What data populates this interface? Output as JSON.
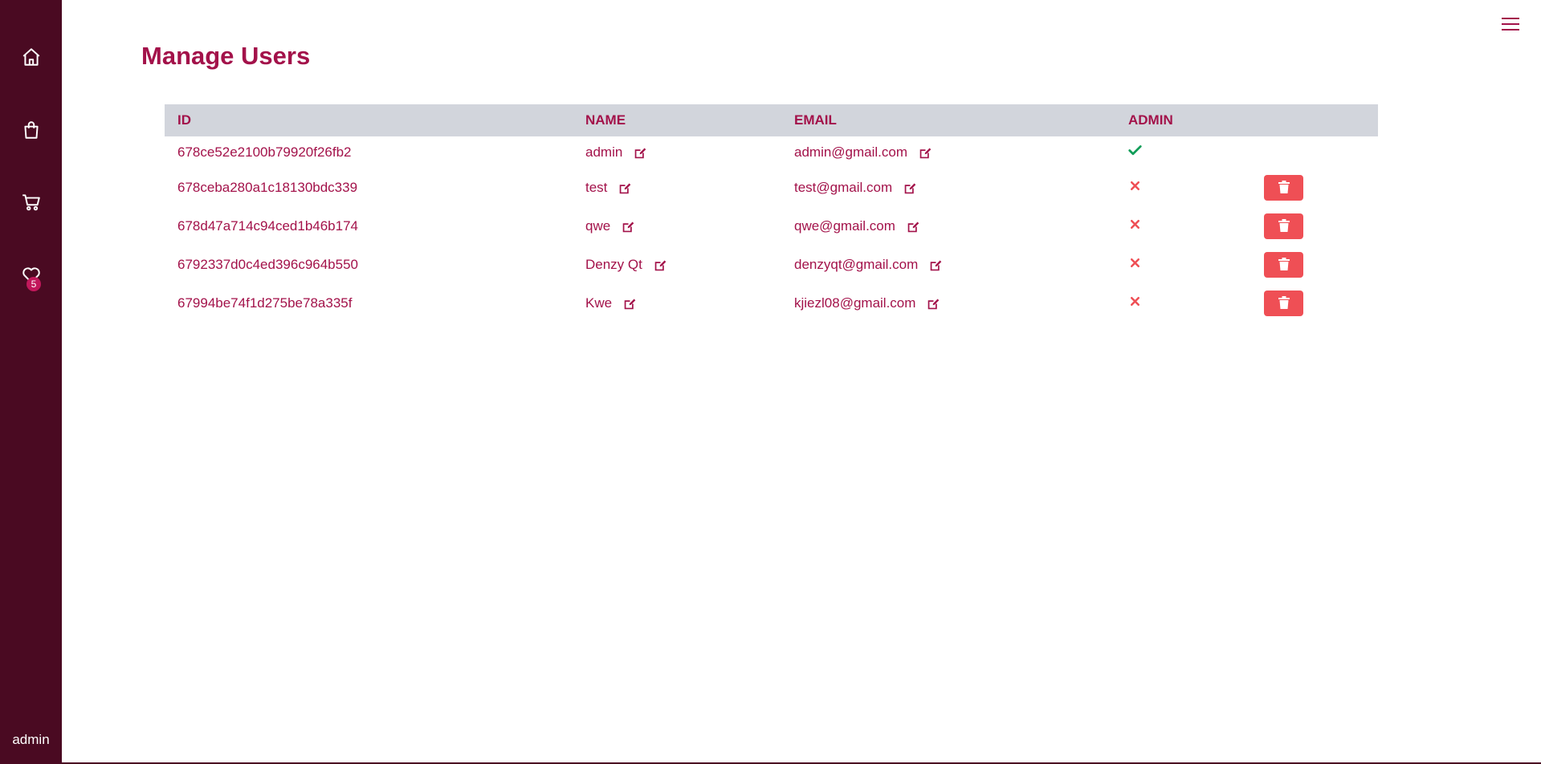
{
  "sidebar": {
    "wishlist_count": "5",
    "user_label": "admin"
  },
  "page": {
    "title": "Manage Users"
  },
  "table": {
    "headers": {
      "id": "ID",
      "name": "NAME",
      "email": "EMAIL",
      "admin": "ADMIN"
    },
    "rows": [
      {
        "id": "678ce52e2100b79920f26fb2",
        "name": "admin",
        "email": "admin@gmail.com",
        "is_admin": true
      },
      {
        "id": "678ceba280a1c18130bdc339",
        "name": "test",
        "email": "test@gmail.com",
        "is_admin": false
      },
      {
        "id": "678d47a714c94ced1b46b174",
        "name": "qwe",
        "email": "qwe@gmail.com",
        "is_admin": false
      },
      {
        "id": "6792337d0c4ed396c964b550",
        "name": "Denzy Qt",
        "email": "denzyqt@gmail.com",
        "is_admin": false
      },
      {
        "id": "67994be74f1d275be78a335f",
        "name": "Kwe",
        "email": "kjiezl08@gmail.com",
        "is_admin": false
      }
    ]
  },
  "colors": {
    "sidebar_bg": "#4a0a22",
    "accent": "#a3124a",
    "header_bg": "#d2d5dc",
    "check": "#0f9d58",
    "cross": "#ef4f55",
    "delete_bg": "#ef4f55"
  }
}
